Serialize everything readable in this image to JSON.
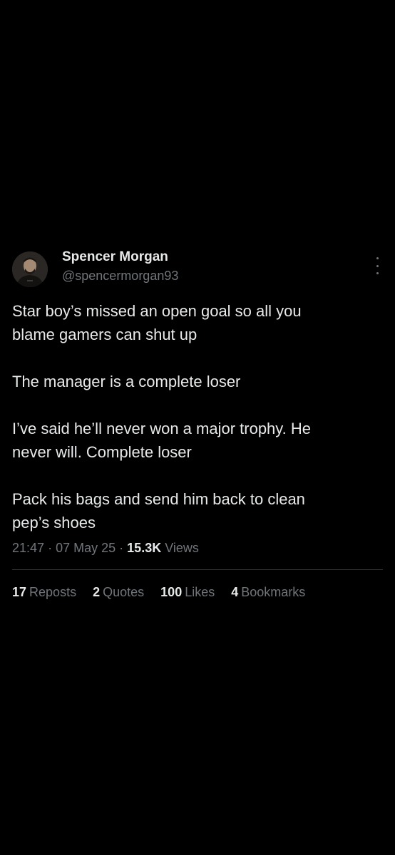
{
  "author": {
    "name": "Spencer Morgan",
    "handle": "@spencermorgan93"
  },
  "menu_icon": "more-vertical-icon",
  "tweet": {
    "paragraphs": [
      "Star boy’s missed an open goal so all you\nblame gamers can shut up",
      "The manager is a complete loser",
      "I’ve said he’ll never won a major trophy. He\nnever will. Complete loser",
      "Pack his bags and send him back to clean\npep’s shoes"
    ],
    "time": "21:47",
    "date": "07 May 25",
    "separator": "·",
    "views_count": "15.3K",
    "views_label": "Views"
  },
  "stats": {
    "reposts": {
      "count": "17",
      "label": "Reposts"
    },
    "quotes": {
      "count": "2",
      "label": "Quotes"
    },
    "likes": {
      "count": "100",
      "label": "Likes"
    },
    "bookmarks": {
      "count": "4",
      "label": "Bookmarks"
    }
  },
  "colors": {
    "background": "#000000",
    "text_primary": "#e7e9ea",
    "text_secondary": "#71767b",
    "divider": "#2f3336"
  }
}
